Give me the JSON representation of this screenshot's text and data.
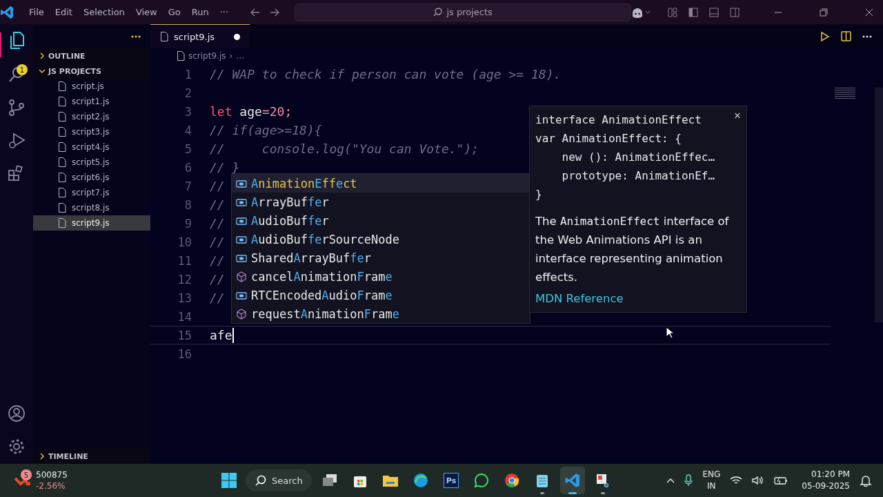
{
  "title_bar": {
    "menu": [
      "File",
      "Edit",
      "Selection",
      "View",
      "Go",
      "Run",
      "···"
    ],
    "search": "js projects"
  },
  "activity_bar": {
    "badge": "1"
  },
  "sidebar": {
    "sections": [
      {
        "label": "OUTLINE",
        "expanded": false
      },
      {
        "label": "JS PROJECTS",
        "expanded": true
      }
    ],
    "files": [
      {
        "name": "script.js",
        "selected": false
      },
      {
        "name": "script1.js",
        "selected": false
      },
      {
        "name": "script2.js",
        "selected": false
      },
      {
        "name": "script3.js",
        "selected": false
      },
      {
        "name": "script4.js",
        "selected": false
      },
      {
        "name": "script5.js",
        "selected": false
      },
      {
        "name": "script6.js",
        "selected": false
      },
      {
        "name": "script7.js",
        "selected": false
      },
      {
        "name": "script8.js",
        "selected": false
      },
      {
        "name": "script9.js",
        "selected": true
      }
    ],
    "timeline": {
      "label": "TIMELINE",
      "expanded": false
    }
  },
  "editor": {
    "tab": {
      "label": "script9.js",
      "modified": true
    },
    "breadcrumb": [
      "script9.js",
      "›",
      "…"
    ],
    "lines": [
      {
        "number": "1",
        "tokens": [
          {
            "text": "// WAP to check if person can vote (age >= 18).",
            "kind": "comment"
          }
        ]
      },
      {
        "number": "2"
      },
      {
        "number": "3",
        "tokens": [
          {
            "text": "let",
            "kind": "keyword"
          },
          {
            "text": " age",
            "kind": "plain"
          },
          {
            "text": "=20;",
            "kind": "number"
          }
        ]
      },
      {
        "number": "4",
        "tokens": [
          {
            "text": "// if(age>=18){",
            "kind": "comment"
          }
        ]
      },
      {
        "number": "5",
        "tokens": [
          {
            "text": "//     console.log(\"You can Vote.\");",
            "kind": "comment"
          }
        ]
      },
      {
        "number": "6",
        "tokens": [
          {
            "text": "// }",
            "kind": "comment"
          }
        ]
      },
      {
        "number": "7",
        "tokens": [
          {
            "text": "//",
            "kind": "comment"
          }
        ]
      },
      {
        "number": "8",
        "tokens": [
          {
            "text": "//",
            "kind": "comment"
          }
        ]
      },
      {
        "number": "9",
        "tokens": [
          {
            "text": "//",
            "kind": "comment"
          }
        ]
      },
      {
        "number": "10",
        "tokens": [
          {
            "text": "//",
            "kind": "comment"
          }
        ]
      },
      {
        "number": "11",
        "tokens": [
          {
            "text": "//",
            "kind": "comment"
          }
        ]
      },
      {
        "number": "12",
        "tokens": [
          {
            "text": "//",
            "kind": "comment"
          }
        ]
      },
      {
        "number": "13",
        "tokens": [
          {
            "text": "//",
            "kind": "comment"
          }
        ]
      },
      {
        "number": "14"
      },
      {
        "number": "15",
        "tokens": [
          {
            "text": "afe",
            "kind": "plain"
          }
        ],
        "current": true
      },
      {
        "number": "16"
      }
    ],
    "suggestions": [
      {
        "label": "**A**nimation**E**ff**e**ct",
        "kind": "class",
        "selected": true
      },
      {
        "label": "**A**rrayBuf**fe**r",
        "kind": "class",
        "selected": false
      },
      {
        "label": "**A**udioBuf**fe**r",
        "kind": "class",
        "selected": false
      },
      {
        "label": "**A**udioBuf**fe**rSourceNode",
        "kind": "class",
        "selected": false
      },
      {
        "label": "Shared**A**rrayBuf**fe**r",
        "kind": "class",
        "selected": false
      },
      {
        "label": "cancel**A**nimation**F**ram**e**",
        "kind": "method",
        "selected": false
      },
      {
        "label": "RTCEncoded**A**udio**F**ram**e**",
        "kind": "class",
        "selected": false
      },
      {
        "label": "request**A**nimation**F**ram**e**",
        "kind": "method",
        "selected": false
      }
    ],
    "details": {
      "signature": [
        "interface AnimationEffect",
        "var AnimationEffect: {",
        "    new (): AnimationEffec…",
        "    prototype: AnimationEf…",
        "}"
      ],
      "description": "The **AnimationEffect** interface of the Web Animations API is an interface representing animation effects.",
      "link": "MDN Reference",
      "close": "×"
    }
  },
  "taskbar": {
    "widget": {
      "badge": "5",
      "value": "500875",
      "change": "-2.56%"
    },
    "search": "Search",
    "apps": [
      {
        "kind": "taskview",
        "running": false,
        "selected": false
      },
      {
        "kind": "store",
        "running": false,
        "selected": false
      },
      {
        "kind": "explorer",
        "running": false,
        "selected": false
      },
      {
        "kind": "edge",
        "running": false,
        "selected": false
      },
      {
        "kind": "photoshop",
        "label": "Ps",
        "running": false,
        "selected": false
      },
      {
        "kind": "whatsapp",
        "running": false,
        "selected": false
      },
      {
        "kind": "chrome",
        "running": false,
        "selected": false
      },
      {
        "kind": "notepad",
        "running": true,
        "selected": false
      },
      {
        "kind": "vscode",
        "running": true,
        "selected": true
      },
      {
        "kind": "snip",
        "running": true,
        "selected": false
      }
    ],
    "language": [
      "ENG",
      "IN"
    ],
    "time": "01:20 PM",
    "date": "05-09-2025"
  }
}
